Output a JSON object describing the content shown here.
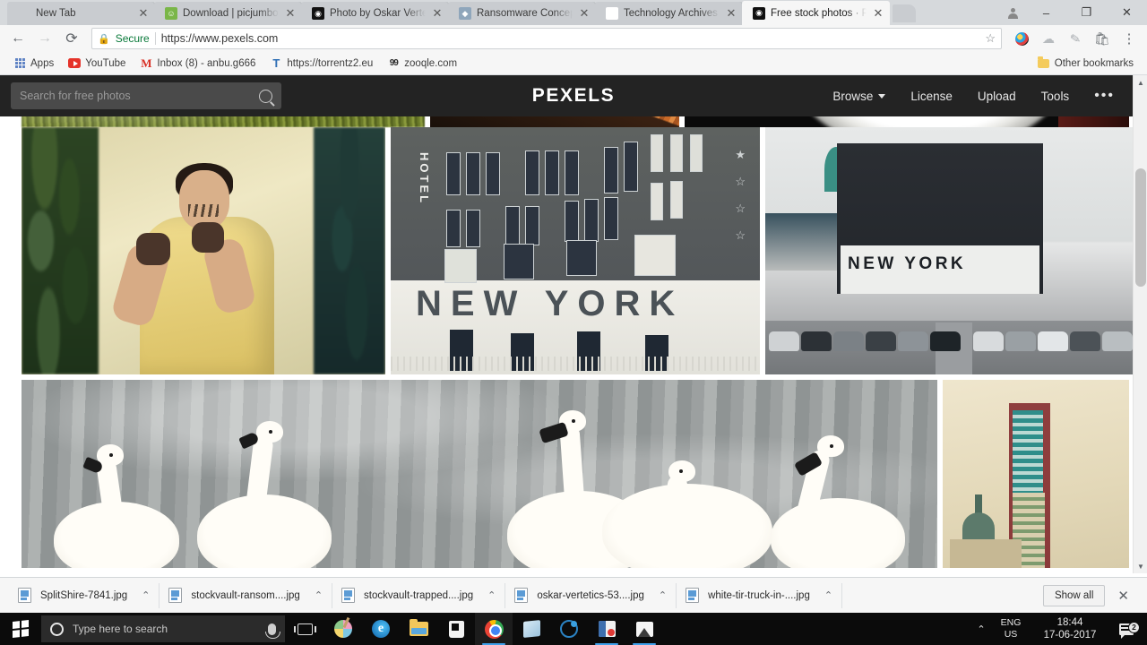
{
  "browser": {
    "tabs": [
      {
        "title": "New Tab",
        "favicon": "newtab-icon",
        "active": false
      },
      {
        "title": "Download | picjumbo –",
        "favicon": "picjumbo-icon",
        "active": false
      },
      {
        "title": "Photo by Oskar Vertetic",
        "favicon": "camera-icon",
        "active": false
      },
      {
        "title": "Ransomware Concept w",
        "favicon": "ransomware-icon",
        "active": false
      },
      {
        "title": "Technology Archives - S",
        "favicon": "splitshire-icon",
        "active": false
      },
      {
        "title": "Free stock photos · Pexe",
        "favicon": "pexels-camera-icon",
        "active": true
      }
    ],
    "window_controls": {
      "minimize": "–",
      "maximize": "❐",
      "close": "✕"
    },
    "toolbar": {
      "back": "←",
      "forward": "→",
      "reload": "⟳",
      "secure_label": "Secure",
      "url": "https://www.pexels.com",
      "star": "☆",
      "menu": "⋮"
    },
    "bookmarks": [
      {
        "label": "Apps",
        "icon": "apps-grid-icon"
      },
      {
        "label": "YouTube",
        "icon": "youtube-icon"
      },
      {
        "label": "Inbox (8) - anbu.g666",
        "icon": "gmail-icon"
      },
      {
        "label": "https://torrentz2.eu",
        "icon": "torrentz-icon"
      },
      {
        "label": "zooqle.com",
        "icon": "zooqle-icon"
      }
    ],
    "other_bookmarks": "Other bookmarks"
  },
  "pexels": {
    "search_placeholder": "Search for free photos",
    "search_value": "",
    "logo": "PEXELS",
    "nav": [
      {
        "label": "Browse",
        "has_caret": true
      },
      {
        "label": "License",
        "has_caret": false
      },
      {
        "label": "Upload",
        "has_caret": false
      },
      {
        "label": "Tools",
        "has_caret": false
      }
    ],
    "overflow": "•••",
    "photos": [
      {
        "alt": "green grassy field",
        "row": 0
      },
      {
        "alt": "orange roof tiles",
        "row": 0
      },
      {
        "alt": "white plate on dark table",
        "row": 0
      },
      {
        "alt": "woman fighter in yellow top with face paint",
        "row": 1
      },
      {
        "alt": "Hotel New York brick facade with large NEW YORK lettering",
        "row": 1,
        "text": [
          "HOTEL",
          "NEW YORK"
        ]
      },
      {
        "alt": "Hotel New York building with parking lot full of cars",
        "row": 1,
        "text": [
          "NEW YORK"
        ]
      },
      {
        "alt": "white swans swimming on gray water",
        "row": 2
      },
      {
        "alt": "tall modern tower building",
        "row": 2
      }
    ]
  },
  "downloads": {
    "items": [
      {
        "name": "SplitShire-7841.jpg"
      },
      {
        "name": "stockvault-ransom....jpg"
      },
      {
        "name": "stockvault-trapped....jpg"
      },
      {
        "name": "oskar-vertetics-53....jpg"
      },
      {
        "name": "white-tir-truck-in-....jpg"
      }
    ],
    "caret": "⌃",
    "show_all": "Show all",
    "close": "✕"
  },
  "taskbar": {
    "search_placeholder": "Type here to search",
    "apps": [
      {
        "name": "paint-3d",
        "running": false
      },
      {
        "name": "microsoft-edge",
        "running": false
      },
      {
        "name": "file-explorer",
        "running": false
      },
      {
        "name": "microsoft-store",
        "running": false
      },
      {
        "name": "google-chrome",
        "running": true,
        "active": true
      },
      {
        "name": "onenote",
        "running": false
      },
      {
        "name": "blue-app",
        "running": false
      },
      {
        "name": "screen-recorder",
        "running": true
      },
      {
        "name": "photos",
        "running": true
      }
    ],
    "tray": {
      "chevron": "⌃",
      "lang_line1": "ENG",
      "lang_line2": "US",
      "time": "18:44",
      "date": "17-06-2017",
      "notification_count": "2"
    }
  }
}
